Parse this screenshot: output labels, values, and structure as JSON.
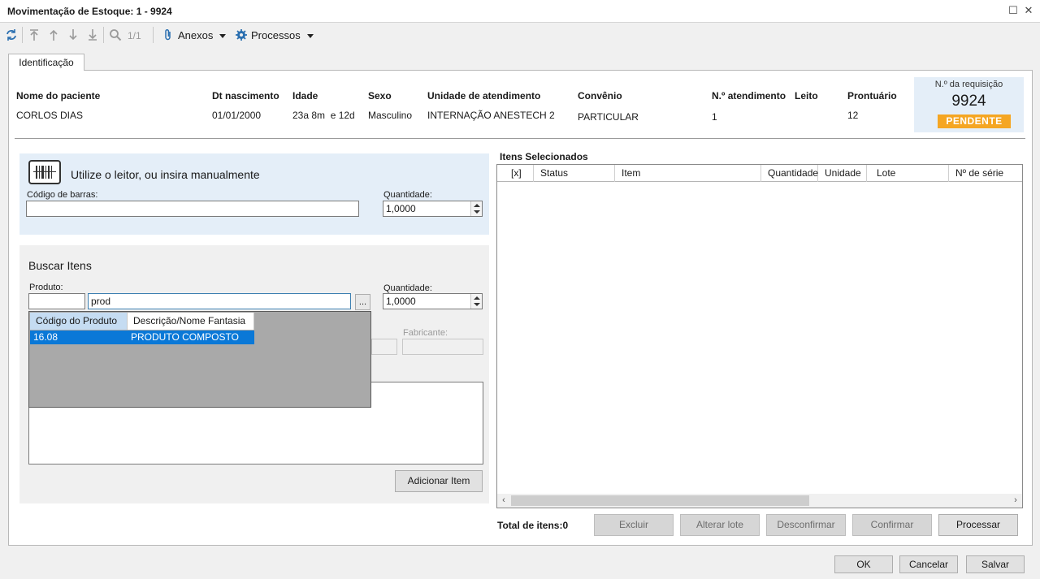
{
  "window": {
    "title": "Movimentação de Estoque: 1 - 9924"
  },
  "toolbar": {
    "icons": [
      "refresh-icon",
      "first-record-icon",
      "previous-record-icon",
      "next-record-icon",
      "last-record-icon",
      "search-icon"
    ],
    "record_counter": "1/1",
    "attachments_label": "Anexos",
    "processes_label": "Processos"
  },
  "tabs": [
    {
      "label": "Identificação",
      "active": true
    }
  ],
  "patient": {
    "name_label": "Nome do paciente",
    "name": "CORLOS DIAS",
    "birth_label": "Dt nascimento",
    "birth": "01/01/2000",
    "age_label": "Idade",
    "age": "23a 8m  e 12d",
    "sex_label": "Sexo",
    "sex": "Masculino",
    "unit_label": "Unidade de atendimento",
    "unit": "INTERNAÇÃO ANESTECH 2",
    "plan_label": "Convênio",
    "plan": "PARTICULAR",
    "visit_label": "N.º atendimento",
    "visit": "1",
    "bed_label": "Leito",
    "bed": "",
    "record_label": "Prontuário",
    "record": "12"
  },
  "request": {
    "label": "N.º da requisição",
    "number": "9924",
    "status": "PENDENTE",
    "status_color": "#f5a623"
  },
  "scanner": {
    "title": "Utilize o leitor, ou insira manualmente",
    "barcode_label": "Código de barras:",
    "barcode_value": "",
    "quantity_label": "Quantidade:",
    "quantity_value": "1,0000"
  },
  "search": {
    "title": "Buscar Itens",
    "product_label": "Produto:",
    "product_code": "",
    "product_query": "prod",
    "browse_label": "...",
    "quantity_label": "Quantidade:",
    "quantity_value": "1,0000",
    "manufacturer_label": "Fabricante:",
    "add_button": "Adicionar Item",
    "dropdown": {
      "columns": [
        "Código do Produto",
        "Descrição/Nome Fantasia"
      ],
      "rows": [
        {
          "code": "16.08",
          "description": "PRODUTO COMPOSTO"
        }
      ]
    }
  },
  "selected": {
    "title": "Itens Selecionados",
    "columns": [
      "[x]",
      "Status",
      "Item",
      "Quantidade",
      "Unidade",
      "Lote",
      "Nº de série"
    ],
    "total_label": "Total de itens:0",
    "buttons": {
      "delete": "Excluir",
      "change_lot": "Alterar lote",
      "unconfirm": "Desconfirmar",
      "confirm": "Confirmar",
      "process": "Processar"
    }
  },
  "footer": {
    "ok": "OK",
    "cancel": "Cancelar",
    "save": "Salvar"
  },
  "colors": {
    "accent_panel": "#e4eef8",
    "selection": "#0a78d7"
  }
}
